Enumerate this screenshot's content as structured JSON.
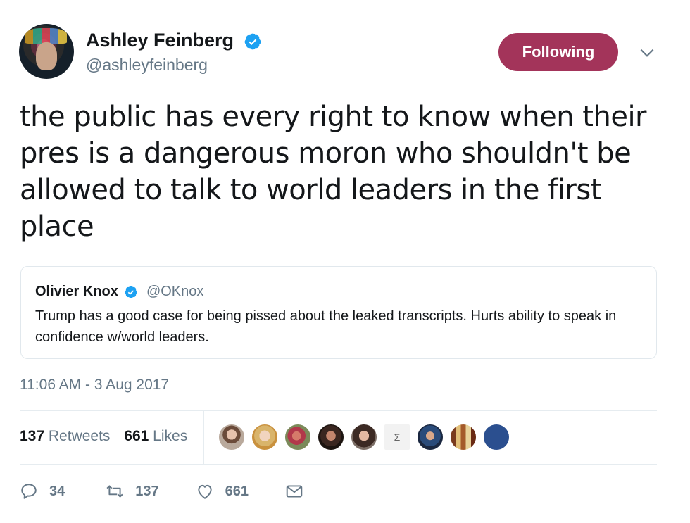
{
  "author": {
    "name": "Ashley Feinberg",
    "handle": "@ashleyfeinberg",
    "verified": true,
    "avatar_icon": "avatar"
  },
  "follow_button": {
    "label": "Following",
    "color": "#a3345a"
  },
  "tweet_text": "the public has every right to know when their pres is a dangerous moron who shouldn't be allowed to talk to world leaders in the first place",
  "quoted_tweet": {
    "name": "Olivier Knox",
    "handle": "@OKnox",
    "verified": true,
    "text": "Trump has a good case for being pissed about the leaked transcripts. Hurts ability to speak in confidence w/world leaders."
  },
  "timestamp": "11:06 AM - 3 Aug 2017",
  "stats": {
    "retweets_count": "137",
    "retweets_label": "Retweets",
    "likes_count": "661",
    "likes_label": "Likes"
  },
  "liker_avatars": [
    "avatar-1",
    "avatar-2",
    "avatar-3",
    "avatar-4",
    "avatar-5",
    "avatar-6",
    "avatar-7",
    "avatar-8",
    "avatar-9"
  ],
  "actions": {
    "reply_count": "34",
    "retweet_count": "137",
    "like_count": "661"
  },
  "colors": {
    "accent": "#1da1f2",
    "muted": "#657786",
    "text": "#14171a"
  }
}
